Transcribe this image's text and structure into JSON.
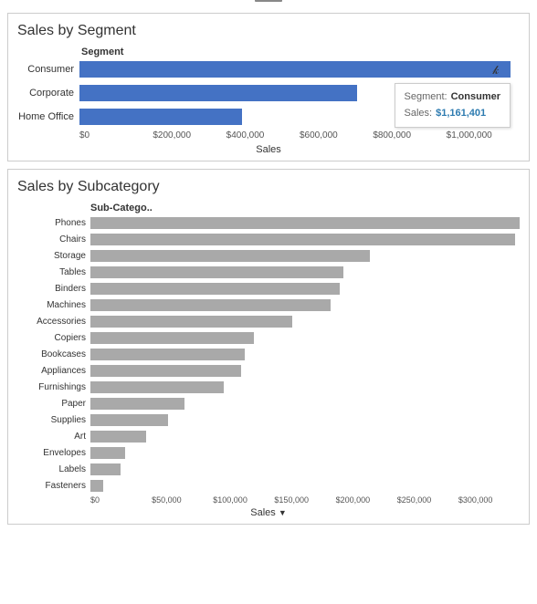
{
  "segmentChart": {
    "title": "Sales by Segment",
    "axisHeader": "Segment",
    "bars": [
      {
        "label": "Consumer",
        "value": 1161401,
        "maxValue": 1200000,
        "pct": 98,
        "color": "blue",
        "highlighted": true
      },
      {
        "label": "Corporate",
        "value": 700000,
        "maxValue": 1200000,
        "pct": 63,
        "color": "blue",
        "highlighted": false
      },
      {
        "label": "Home Office",
        "value": 430000,
        "maxValue": 1200000,
        "pct": 37,
        "color": "blue",
        "highlighted": false
      }
    ],
    "xAxisLabels": [
      "$0",
      "$200,000",
      "$400,000",
      "$600,000",
      "$800,000",
      "$1,000,000"
    ],
    "xAxisTitle": "Sales",
    "tooltip": {
      "segment": "Consumer",
      "segmentLabel": "Segment:",
      "salesLabel": "Sales:",
      "salesValue": "$1,161,401"
    }
  },
  "subcategoryChart": {
    "title": "Sales by Subcategory",
    "axisHeader": "Sub-Catego..",
    "bars": [
      {
        "label": "Phones",
        "pct": 100
      },
      {
        "label": "Chairs",
        "pct": 99
      },
      {
        "label": "Storage",
        "pct": 65
      },
      {
        "label": "Tables",
        "pct": 59
      },
      {
        "label": "Binders",
        "pct": 58
      },
      {
        "label": "Machines",
        "pct": 56
      },
      {
        "label": "Accessories",
        "pct": 47
      },
      {
        "label": "Copiers",
        "pct": 38
      },
      {
        "label": "Bookcases",
        "pct": 36
      },
      {
        "label": "Appliances",
        "pct": 35
      },
      {
        "label": "Furnishings",
        "pct": 31
      },
      {
        "label": "Paper",
        "pct": 22
      },
      {
        "label": "Supplies",
        "pct": 18
      },
      {
        "label": "Art",
        "pct": 13
      },
      {
        "label": "Envelopes",
        "pct": 8
      },
      {
        "label": "Labels",
        "pct": 7
      },
      {
        "label": "Fasteners",
        "pct": 3
      }
    ],
    "xAxisLabels": [
      "$0",
      "$50,000",
      "$100,000",
      "$150,000",
      "$200,000",
      "$250,000",
      "$300,000"
    ],
    "xAxisTitle": "Sales",
    "filterIcon": "▼"
  }
}
